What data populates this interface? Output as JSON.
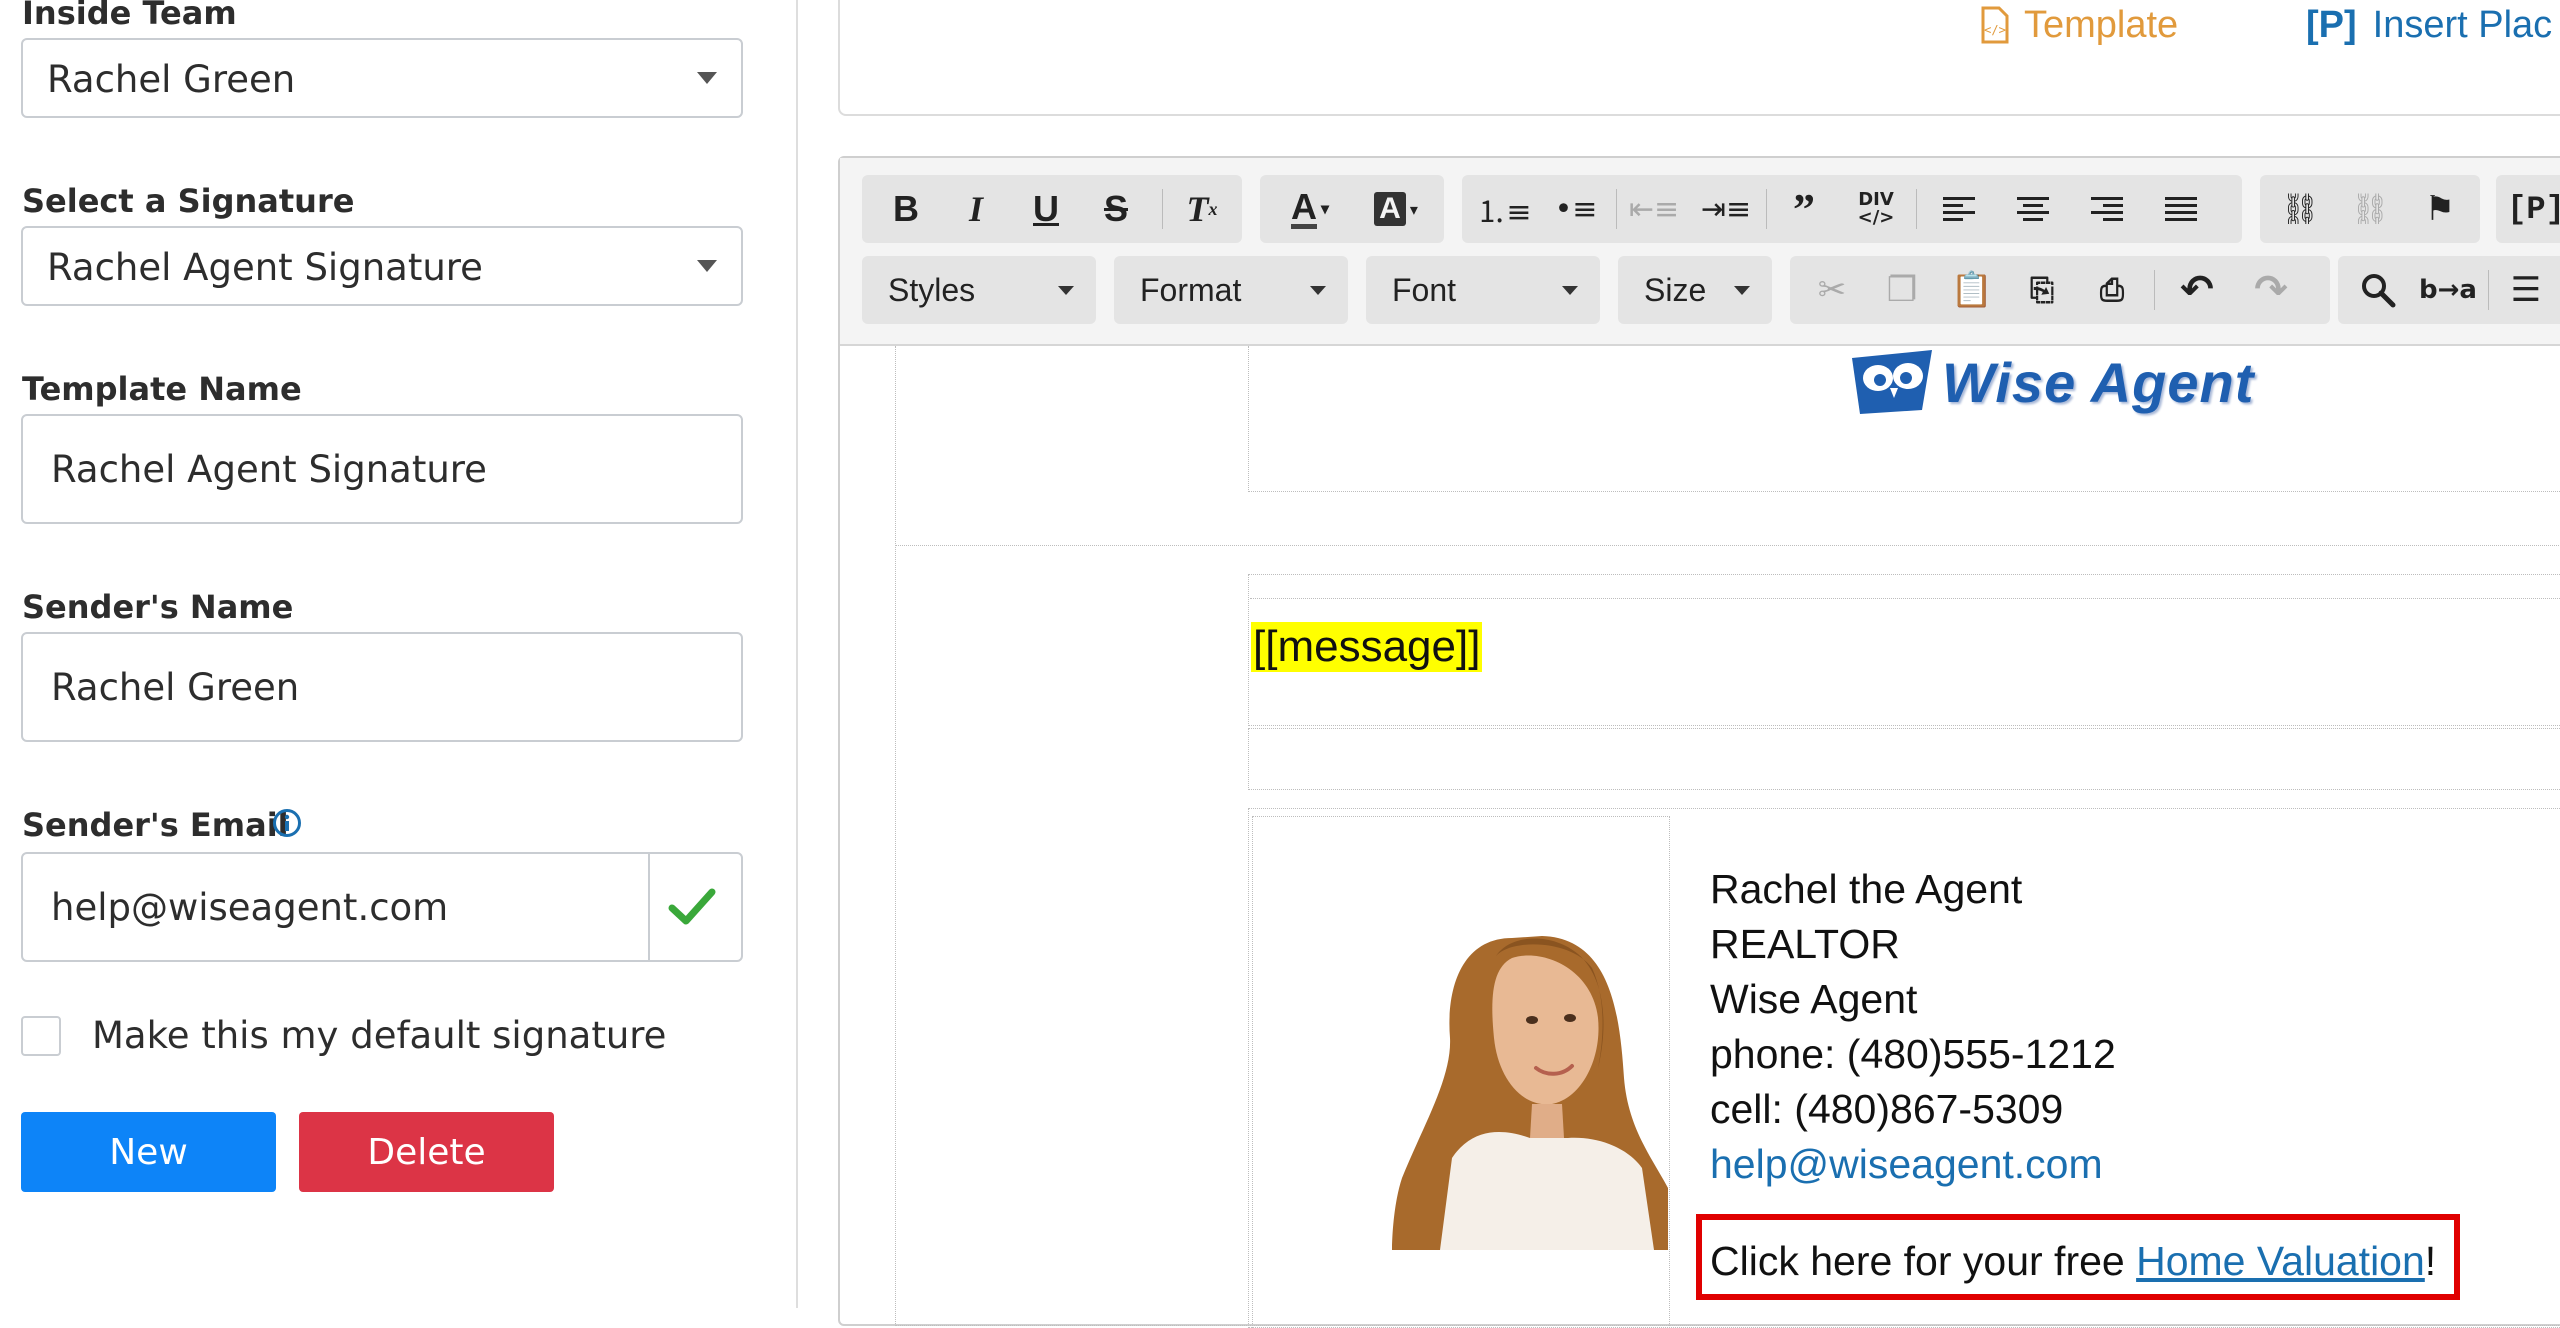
{
  "form": {
    "inside_team_label": "Inside Team",
    "inside_team_value": "Rachel Green",
    "signature_label": "Select a Signature",
    "signature_value": "Rachel Agent Signature",
    "template_name_label": "Template Name",
    "template_name_value": "Rachel Agent Signature",
    "sender_name_label": "Sender's Name",
    "sender_name_value": "Rachel Green",
    "sender_email_label": "Sender's Email",
    "sender_email_value": "help@wiseagent.com",
    "default_checkbox_label": "Make this my default signature",
    "new_button": "New",
    "delete_button": "Delete"
  },
  "editor_top": {
    "template_link": "Template",
    "insert_placeholder_link": "Insert Plac"
  },
  "toolbar": {
    "styles": "Styles",
    "format": "Format",
    "font": "Font",
    "size": "Size"
  },
  "content": {
    "logo_text": "Wise Agent",
    "placeholder": "[[message]]",
    "sig_name": "Rachel the Agent",
    "sig_title": "REALTOR",
    "sig_company": "Wise Agent",
    "sig_phone": "phone: (480)555-1212",
    "sig_cell": "cell: (480)867-5309",
    "sig_email": "help@wiseagent.com",
    "cta_prefix": "Click here for your free ",
    "cta_link": "Home Valuation",
    "cta_suffix": "!"
  },
  "colors": {
    "new_button": "#0d84f8",
    "delete_button": "#dc3446",
    "link": "#1a6fb0",
    "highlight": "#ffff00",
    "cta_border": "#e00000",
    "valid_check": "#3aa83a"
  }
}
